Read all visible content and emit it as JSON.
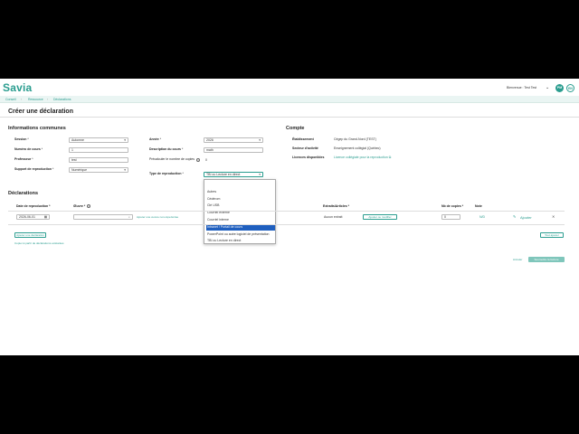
{
  "header": {
    "logo": "Savia",
    "welcome": "Bienvenue : Test Test",
    "chevron": "⌄",
    "avatar_initials": "PM",
    "lang": "EN"
  },
  "breadcrumb": {
    "items": [
      "Conseil",
      "Ressource",
      "Déclarations"
    ],
    "sep": "›"
  },
  "page_title": "Créer une déclaration",
  "common": {
    "section_title": "Informations communes",
    "session_label": "Session",
    "session_value": "Automne",
    "course_number_label": "Numéro de cours",
    "course_number_value": "1",
    "teacher_label": "Professeur",
    "teacher_value": "test",
    "support_label": "Support de reproduction",
    "support_value": "Numérique",
    "year_label": "Année",
    "year_value": "2026",
    "course_desc_label": "Description du cours",
    "course_desc_value": "math",
    "precalc_label": "Précalculer le nombre de copies",
    "precalc_value": "0",
    "repro_type_label": "Type de reproduction",
    "repro_type_value": "TBI ou Lecture en direct",
    "required_mark": "*",
    "caret": "▾"
  },
  "repro_type_options": [
    "",
    "Autres",
    "Cédérom",
    "Clé USB",
    "Courriel externe",
    "Courriel interne",
    "Intranet / Portail de cours",
    "PowerPoint ou autre logiciel de présentation",
    "TBI ou Lecture en direct"
  ],
  "repro_type_selected_index": 6,
  "account": {
    "section_title": "Compte",
    "establishment_label": "Établissement",
    "establishment_value": "Cégep du Grand-Nord (TEST)",
    "sector_label": "Secteur d'activité",
    "sector_value": "Enseignement collégial (Québec)",
    "licenses_label": "Licences disponibles",
    "licenses_value": "Licence collégiale pour la reproduction ⧉"
  },
  "declarations": {
    "section_title": "Déclarations",
    "columns": {
      "date": "Date de reproduction *",
      "work": "Œuvre *",
      "extracts": "Extraits/Articles *",
      "copies": "Nb de copies *",
      "note": "Note"
    },
    "row": {
      "date": "2026-06-01",
      "calendar_icon": "▦",
      "work_value": "",
      "search_icon": "⌕",
      "add_work_link": "Ajouter une œuvre non-répertoriée",
      "extracts_value": "Aucun extrait",
      "add_extract_button": "Ajouter ou modifier",
      "copies_value": "0",
      "note_value": "N/D",
      "edit_icon": "✎",
      "add_link": "Ajouter",
      "delete_icon": "✕"
    },
    "add_declaration_button": "Ajouter une déclaration",
    "copy_link": "Copier à partir de déclarations existantes",
    "save_all_button": "Tout ajouter"
  },
  "footer": {
    "cancel_link": "Annuler",
    "submit_button": "Soumettre la facture"
  },
  "colors": {
    "accent": "#2a9d8f",
    "selected": "#1f5fbf"
  }
}
